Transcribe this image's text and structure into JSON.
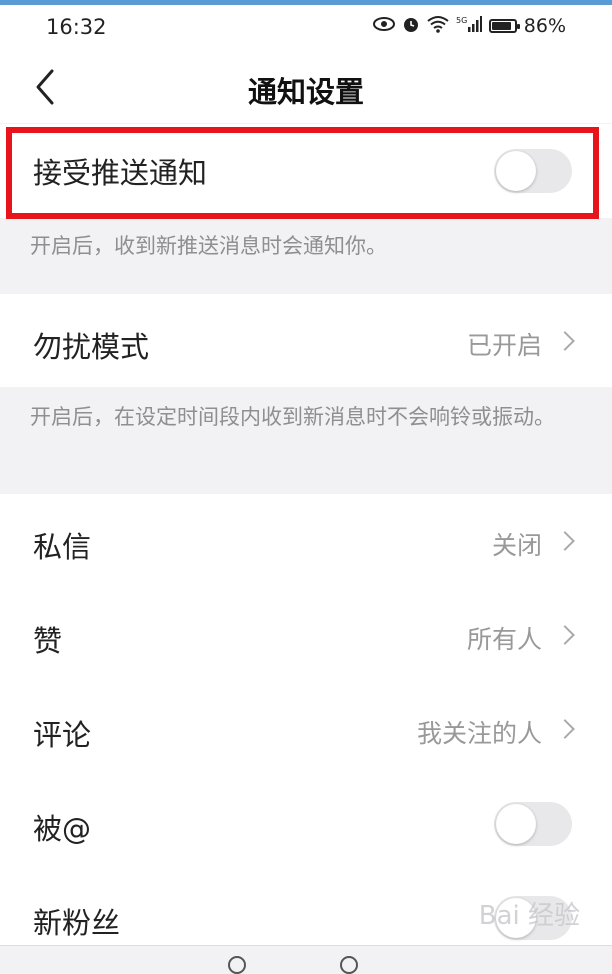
{
  "status_bar": {
    "time": "16:32",
    "battery_percent_text": "86%",
    "battery_level": 0.86,
    "icons": [
      "eye-icon",
      "alarm-icon",
      "wifi-icon",
      "signal-5g-icon",
      "battery-icon"
    ]
  },
  "nav": {
    "title": "通知设置"
  },
  "push": {
    "label": "接受推送通知",
    "enabled": false,
    "hint": "开启后，收到新推送消息时会通知你。"
  },
  "dnd": {
    "label": "勿扰模式",
    "value": "已开启",
    "hint": "开启后，在设定时间段内收到新消息时不会响铃或振动。"
  },
  "settings": [
    {
      "label": "私信",
      "value": "关闭"
    },
    {
      "label": "赞",
      "value": "所有人"
    },
    {
      "label": "评论",
      "value": "我关注的人"
    },
    {
      "label": "被@",
      "toggle": false
    },
    {
      "label": "新粉丝",
      "toggle": false
    }
  ],
  "watermark": "Bai 经验",
  "colors": {
    "highlight": "#e8141c",
    "toggle_off": "#e8e8ea",
    "hint_text": "#8e8e93"
  }
}
